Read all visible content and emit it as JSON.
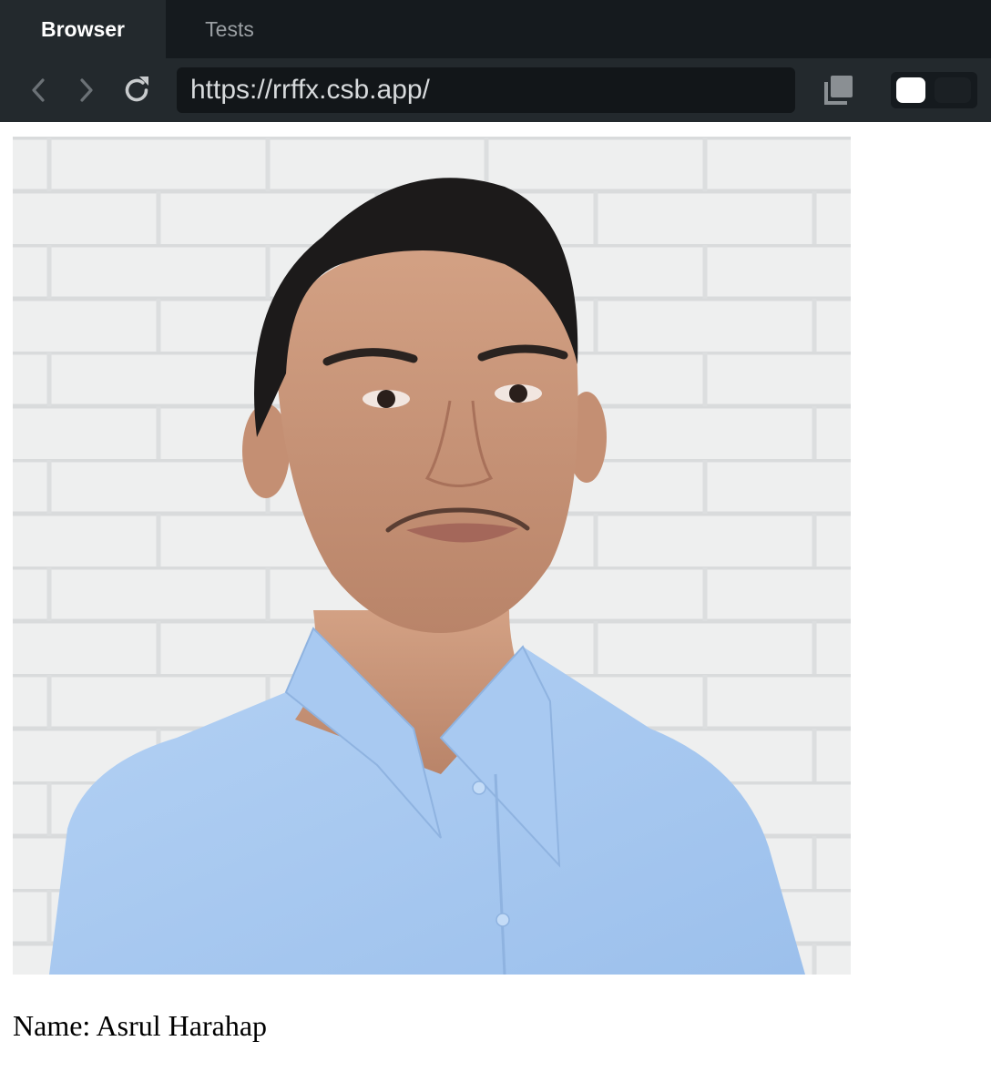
{
  "browser": {
    "tabs": [
      {
        "label": "Browser",
        "active": true
      },
      {
        "label": "Tests",
        "active": false
      }
    ],
    "url": "https://rrffx.csb.app/",
    "icons": {
      "back": "chevron-left-icon",
      "forward": "chevron-right-icon",
      "reload": "reload-icon",
      "copy": "copy-icon"
    },
    "theme_toggle": {
      "state": "light"
    }
  },
  "page": {
    "profile_image": {
      "subject": "portrait-photo",
      "dominant_colors": {
        "wall": "#eceded",
        "shirt": "#a7c8f0",
        "hair": "#1c1a1a",
        "skin": "#c9977a"
      }
    },
    "name_text": "Name: Asrul Harahap"
  },
  "colors": {
    "tabbar_bg": "#151a1e",
    "toolbar_bg": "#23292d",
    "url_bg": "#121619",
    "active_tab_text": "#ffffff",
    "inactive_tab_text": "#9a9fa3"
  }
}
